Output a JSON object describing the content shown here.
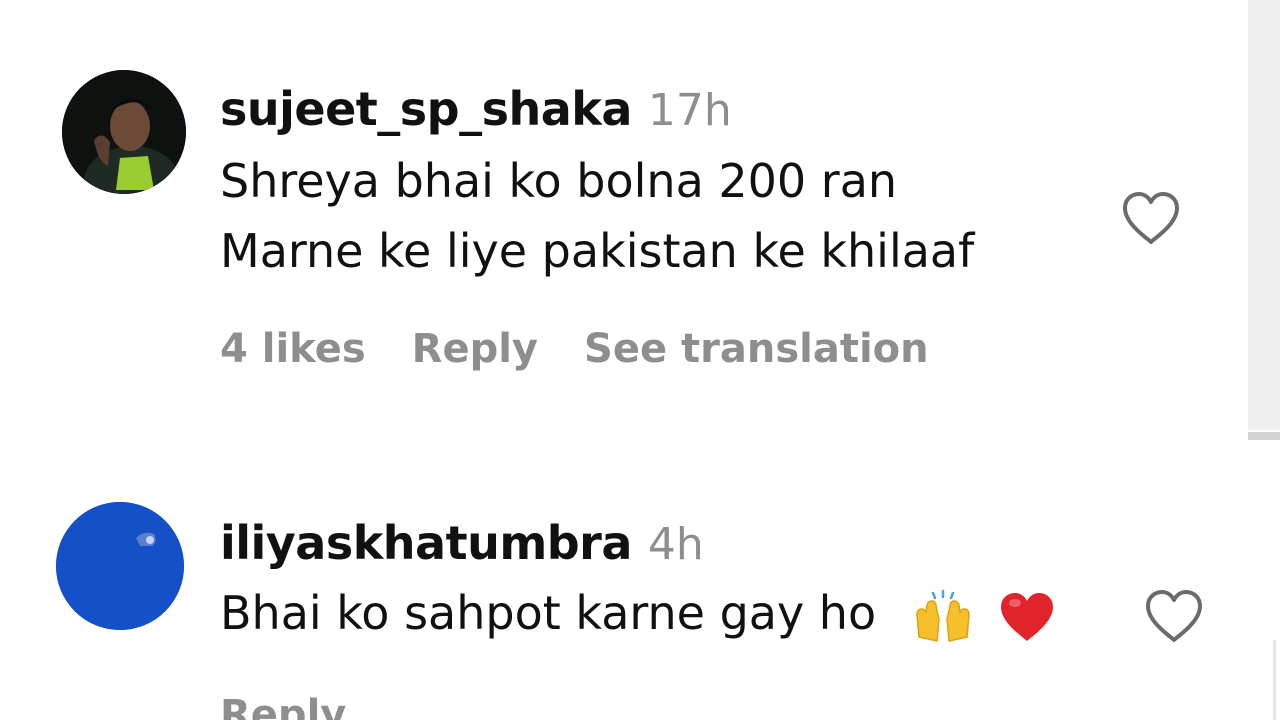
{
  "comments": [
    {
      "username": "sujeet_sp_shaka",
      "time": "17h",
      "text_line1": "Shreya bhai ko bolna 200 ran",
      "text_line2": "Marne ke liye pakistan ke khilaaf",
      "likes": "4 likes",
      "reply": "Reply",
      "translation": "See translation",
      "like_icon": "heart-outline-icon"
    },
    {
      "username": "iliyaskhatumbra",
      "time": "4h",
      "text": "Bhai ko sahpot karne gay ho",
      "emojis": [
        "raising-hands-emoji",
        "red-heart-emoji"
      ],
      "reply": "Reply",
      "like_icon": "heart-outline-icon"
    }
  ]
}
